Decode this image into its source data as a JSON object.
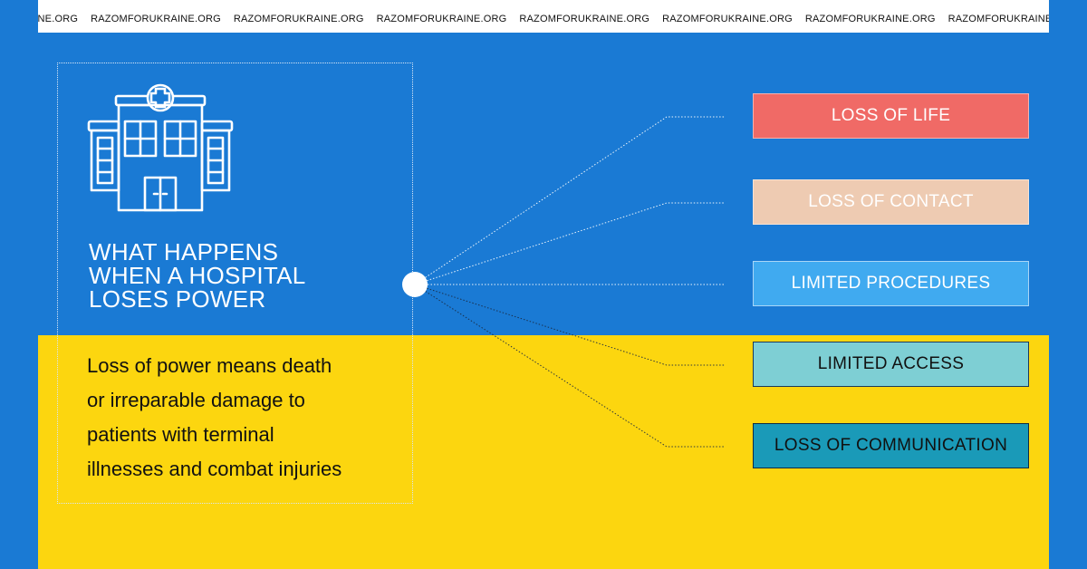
{
  "ticker": {
    "items": [
      "ORUKRAINE.ORG",
      "RAZOMFORUKRAINE.ORG",
      "RAZOMFORUKRAINE.ORG",
      "RAZOMFORUKRAINE.ORG",
      "RAZOMFORUKRAINE.ORG",
      "RAZOMFORUKRAINE.ORG",
      "RAZOMFORUKRAINE.ORG",
      "RAZOMFORUKRAINE.ORG",
      "RAZOMFORUKRAINE.ORG"
    ]
  },
  "icon": {
    "name": "hospital-building-icon"
  },
  "headline": {
    "lines": [
      "WHAT HAPPENS",
      "WHEN A HOSPITAL",
      "LOSES POWER"
    ]
  },
  "body": {
    "lines": [
      "Loss of power means death",
      "or irreparable damage to",
      "patients with terminal",
      "illnesses and combat injuries"
    ]
  },
  "outcomes": [
    {
      "label": "LOSS OF LIFE",
      "bg": "#f06a66",
      "fg": "#ffffff",
      "border": "#f7b2ae"
    },
    {
      "label": "LOSS OF CONTACT",
      "bg": "#eecbb2",
      "fg": "#ffffff",
      "border": "#f6e3d6"
    },
    {
      "label": "LIMITED PROCEDURES",
      "bg": "#40aaf0",
      "fg": "#ffffff",
      "border": "#a9d6f7"
    },
    {
      "label": "LIMITED ACCESS",
      "bg": "#7ecfd4",
      "fg": "#111111",
      "border": "#1a3a5a"
    },
    {
      "label": "LOSS OF COMMUNICATION",
      "bg": "#1a9ab8",
      "fg": "#111111",
      "border": "#0e2c44"
    }
  ],
  "colors": {
    "blue": "#1a7ad4",
    "yellow": "#fcd60f",
    "white": "#ffffff"
  }
}
